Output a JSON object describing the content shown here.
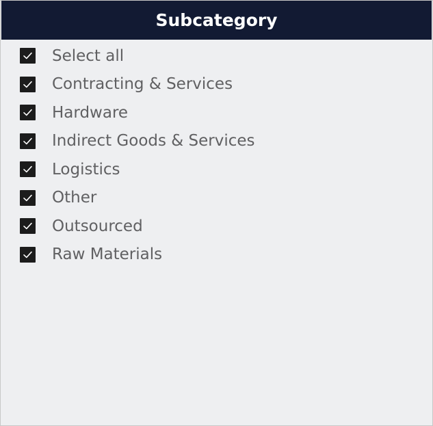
{
  "slicer": {
    "title": "Subcategory",
    "items": [
      {
        "label": "Select all",
        "checked": true
      },
      {
        "label": "Contracting & Services",
        "checked": true
      },
      {
        "label": "Hardware",
        "checked": true
      },
      {
        "label": "Indirect Goods & Services",
        "checked": true
      },
      {
        "label": "Logistics",
        "checked": true
      },
      {
        "label": "Other",
        "checked": true
      },
      {
        "label": "Outsourced",
        "checked": true
      },
      {
        "label": "Raw Materials",
        "checked": true
      }
    ]
  },
  "colors": {
    "header_background": "#121a33",
    "panel_background": "#eeeff1",
    "checkbox_fill": "#1c1c1c",
    "label_text": "#606062"
  },
  "icons": {
    "checkbox_mark": "checkmark-icon"
  }
}
